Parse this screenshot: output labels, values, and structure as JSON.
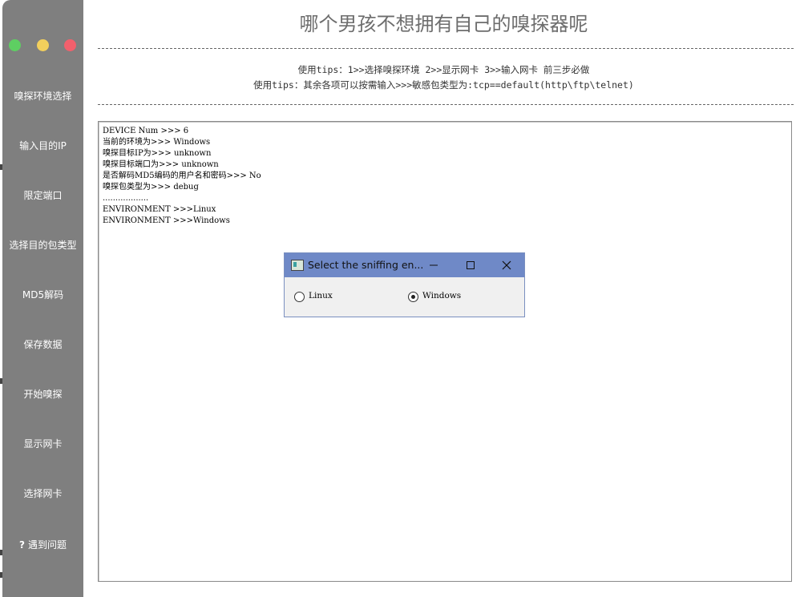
{
  "app": {
    "title": "哪个男孩不想拥有自己的嗅探器呢"
  },
  "colors": {
    "sidebar_bg": "#7f7f7f",
    "dot_green": "#5ecf62",
    "dot_yellow": "#f2cf5c",
    "dot_red": "#f2606c",
    "dialog_titlebar": "#6f89c7"
  },
  "sidebar": {
    "items": [
      {
        "label": "嗅探环境选择"
      },
      {
        "label": "输入目的IP"
      },
      {
        "label": "限定端口"
      },
      {
        "label": "选择目的包类型"
      },
      {
        "label": "MD5解码"
      },
      {
        "label": "保存数据"
      },
      {
        "label": "开始嗅探"
      },
      {
        "label": "显示网卡"
      },
      {
        "label": "选择网卡"
      },
      {
        "label": "遇到问题",
        "icon": "question-icon",
        "glyph": "?"
      }
    ]
  },
  "tips": {
    "line1": "使用tips：1>>选择嗅探环境   2>>显示网卡   3>>输入网卡   前三步必做",
    "line2": "使用tips：其余各项可以按需输入>>>敏感包类型为:tcp==default(http\\ftp\\telnet)"
  },
  "console": {
    "lines": [
      "DEVICE Num >>> 6",
      "当前的环境为>>> Windows",
      "嗅探目标IP为>>> unknown",
      "嗅探目标端口为>>> unknown",
      "是否解码MD5编码的用户名和密码>>> No",
      "嗅探包类型为>>> debug",
      "..................",
      "ENVIRONMENT >>>Linux",
      "ENVIRONMENT >>>Windows"
    ]
  },
  "dialog": {
    "title": "Select the sniffing en...",
    "options": [
      {
        "label": "Linux",
        "checked": false
      },
      {
        "label": "Windows",
        "checked": true
      }
    ]
  }
}
